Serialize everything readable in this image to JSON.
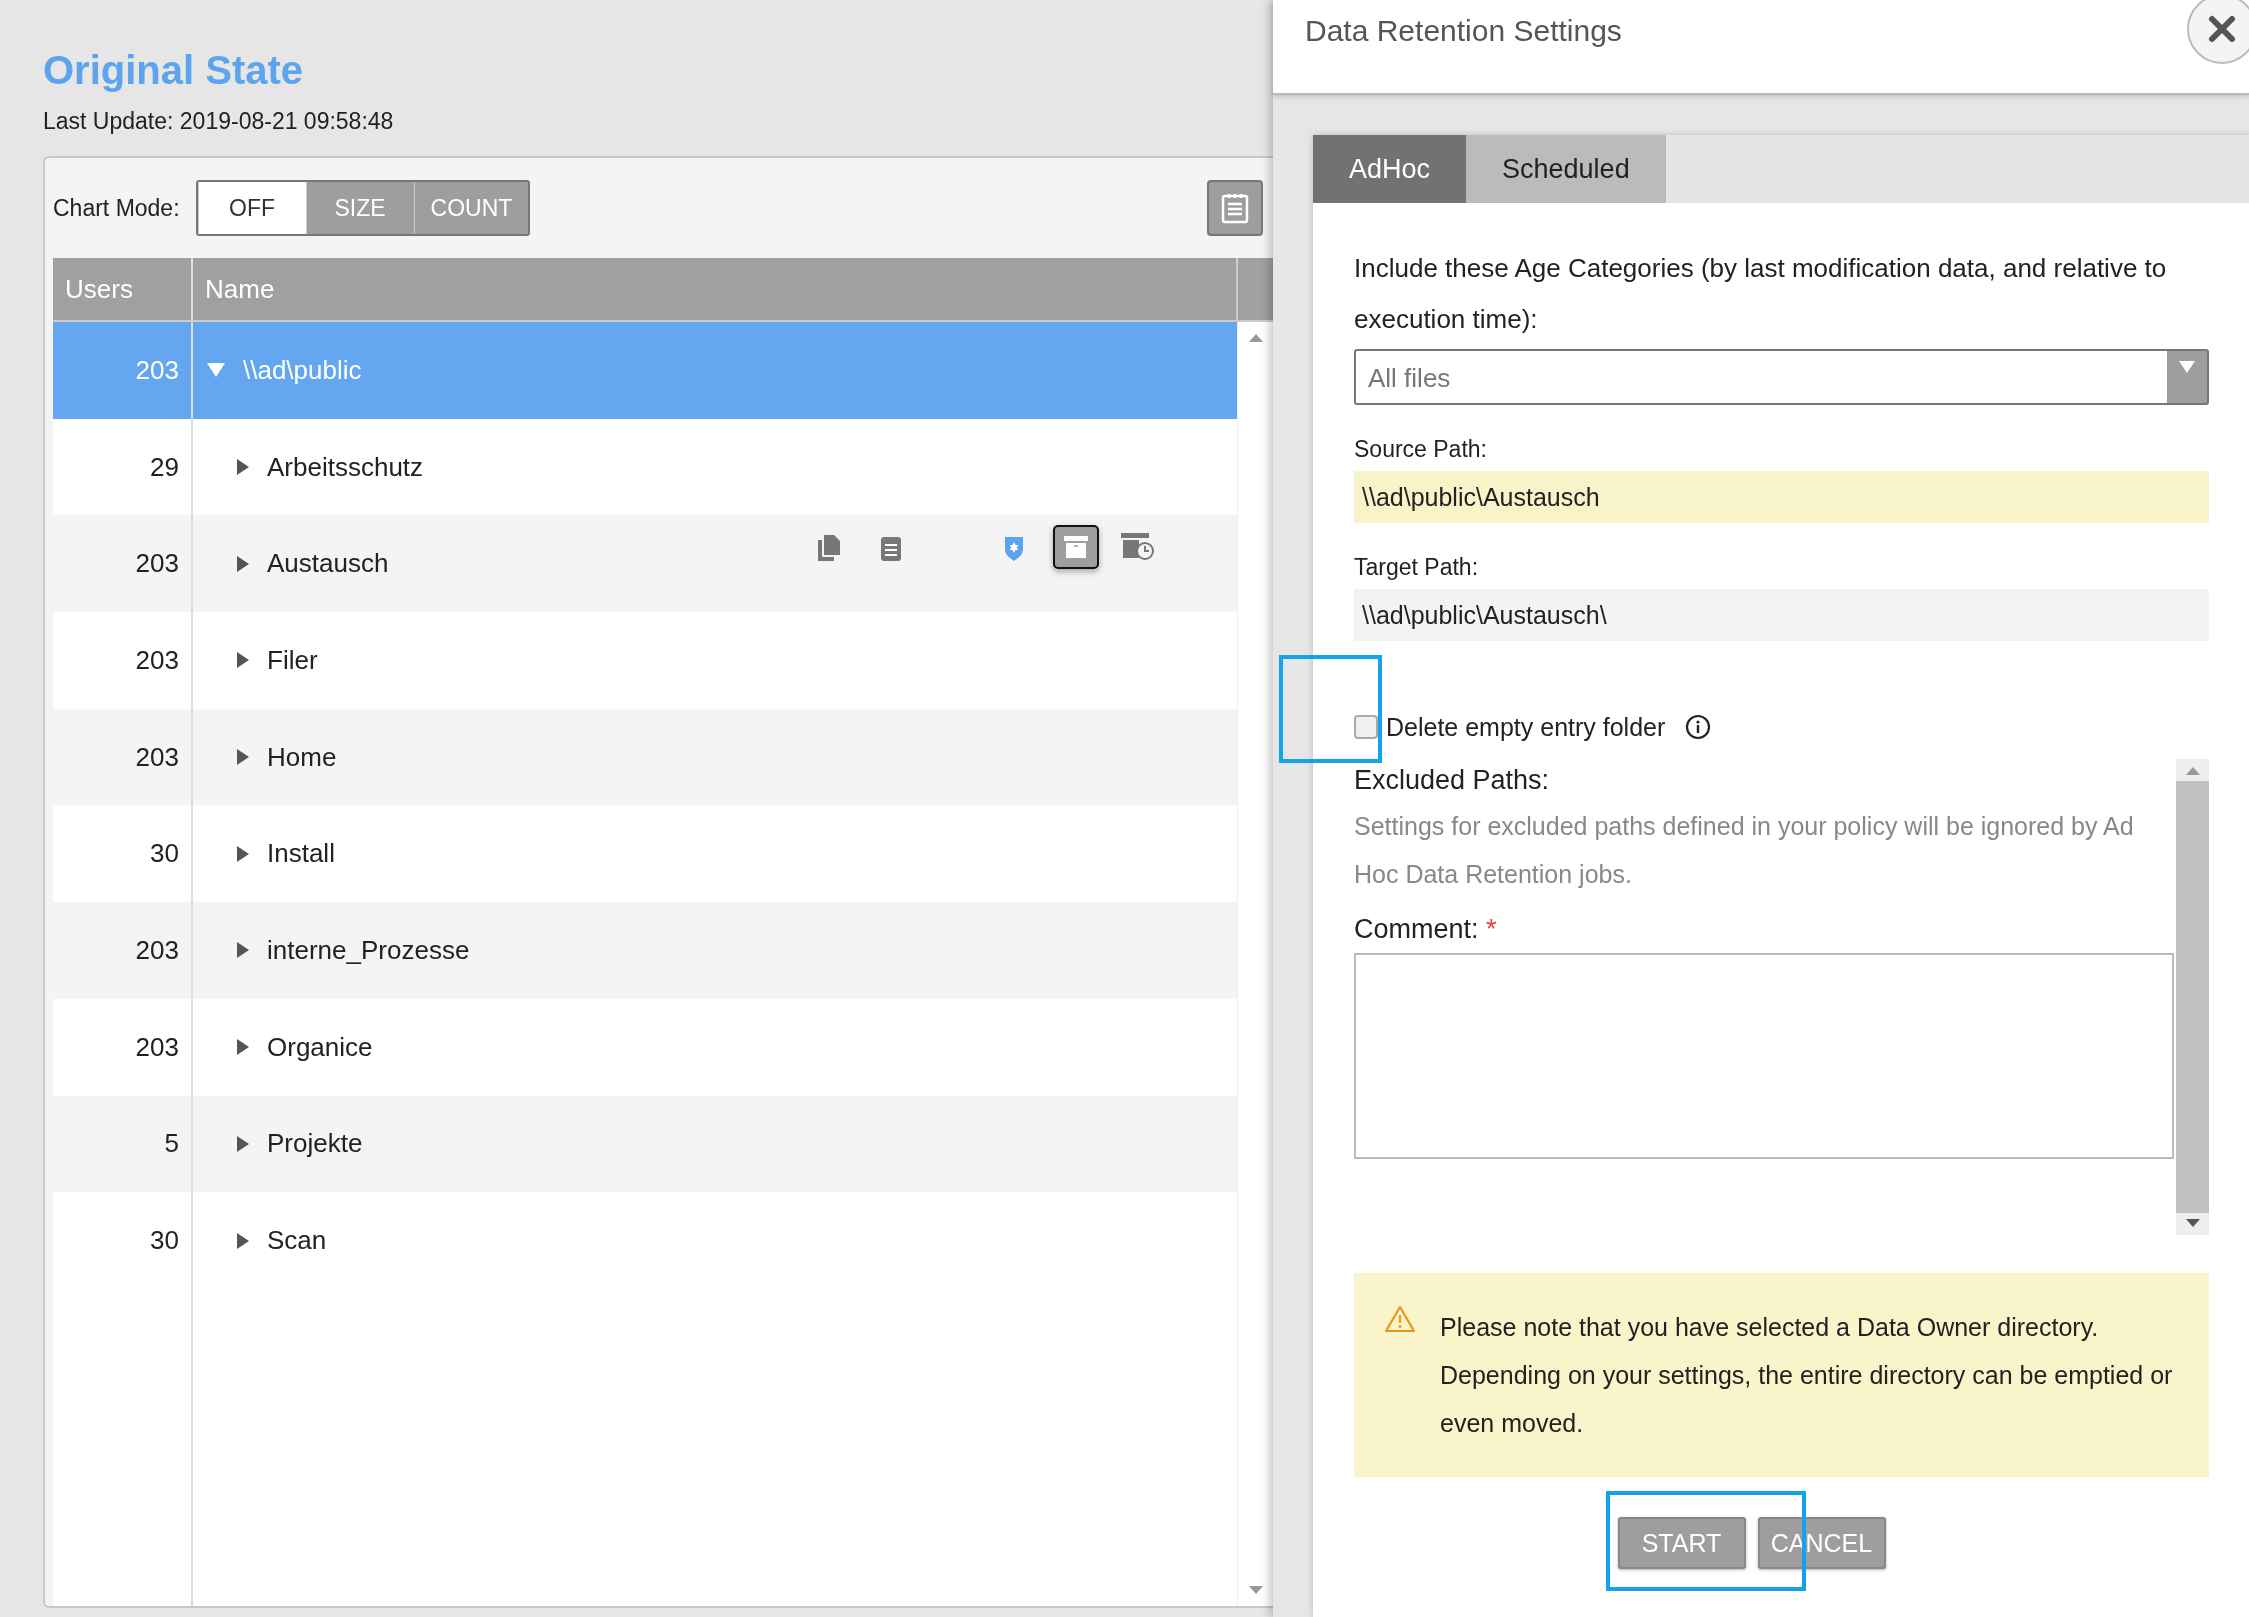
{
  "left": {
    "title": "Original State",
    "last_update": "Last Update: 2019-08-21 09:58:48",
    "chart_mode": {
      "label": "Chart Mode:",
      "options": [
        {
          "label": "OFF",
          "selected": true
        },
        {
          "label": "SIZE",
          "selected": false
        },
        {
          "label": "COUNT",
          "selected": false
        }
      ]
    },
    "table": {
      "columns": [
        "Users",
        "Name"
      ],
      "tree": [
        {
          "users": "203",
          "name": "\\\\ad\\public",
          "expanded": true,
          "selected": true,
          "show_actions": false,
          "children": [
            {
              "users": "29",
              "name": "Arbeitsschutz",
              "expanded": false,
              "selected": false,
              "show_actions": false
            },
            {
              "users": "203",
              "name": "Austausch",
              "expanded": false,
              "selected": false,
              "show_actions": true
            },
            {
              "users": "203",
              "name": "Filer",
              "expanded": false,
              "selected": false,
              "show_actions": false
            },
            {
              "users": "203",
              "name": "Home",
              "expanded": false,
              "selected": false,
              "show_actions": false
            },
            {
              "users": "30",
              "name": "Install",
              "expanded": false,
              "selected": false,
              "show_actions": false
            },
            {
              "users": "203",
              "name": "interne_Prozesse",
              "expanded": false,
              "selected": false,
              "show_actions": false
            },
            {
              "users": "203",
              "name": "Organice",
              "expanded": false,
              "selected": false,
              "show_actions": false
            },
            {
              "users": "5",
              "name": "Projekte",
              "expanded": false,
              "selected": false,
              "show_actions": false
            },
            {
              "users": "30",
              "name": "Scan",
              "expanded": false,
              "selected": false,
              "show_actions": false
            }
          ]
        }
      ]
    }
  },
  "dialog": {
    "title": "Data Retention Settings",
    "tabs": [
      {
        "label": "AdHoc",
        "selected": true
      },
      {
        "label": "Scheduled",
        "selected": false
      }
    ],
    "age_label": "Include these Age Categories (by last modification data, and relative to execution time):",
    "age_select": {
      "value": "All files"
    },
    "source_label": "Source Path:",
    "source_value": "\\\\ad\\public\\Austausch",
    "target_label": "Target Path:",
    "target_value": "\\\\ad\\public\\Austausch\\",
    "delete_empty": {
      "label": "Delete empty entry folder",
      "checked": false
    },
    "excluded_label": "Excluded Paths:",
    "excluded_note": "Settings for excluded paths defined in your policy will be ignored by Ad Hoc Data Retention jobs.",
    "comment_label": "Comment:",
    "comment_required": "*",
    "warning": "Please note that you have selected a Data Owner directory. Depending on your settings, the entire directory can be emptied or even moved.",
    "buttons": [
      "START",
      "CANCEL"
    ]
  }
}
